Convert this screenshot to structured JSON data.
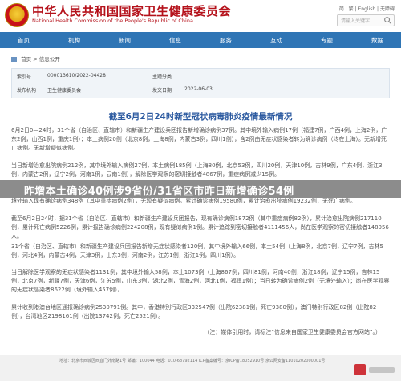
{
  "header": {
    "title_cn": "中华人民共和国国家卫生健康委员会",
    "title_en": "National Health Commission of the People's Republic of China",
    "top_links": "简 | 繁 | English | 无障碍",
    "search_placeholder": "请输入关键字"
  },
  "nav": {
    "items": [
      "首页",
      "机构",
      "新闻",
      "信息",
      "服务",
      "互动",
      "专题",
      "数据"
    ]
  },
  "breadcrumb": {
    "home": "首页",
    "sep": ">",
    "current": "信息公开"
  },
  "meta": {
    "index_label": "索引号",
    "index_value": "000013610/2022-04428",
    "category_label": "主题分类",
    "category_value": "",
    "publisher_label": "发布机构",
    "publisher_value": "卫生健康委员会",
    "date_label": "发文日期",
    "date_value": "2022-06-03"
  },
  "article": {
    "title": "截至6月2日24时新型冠状病毒肺炎疫情最新情况",
    "p1": "6月2日0—24时，31个省（自治区、直辖市）和新疆生产建设兵团报告新增确诊病例37例。其中境外输入病例17例（福建7例，广西4例，上海2例，广东2例，山西1例，重庆1例）；本土病例20例（北京8例，上海8例，内蒙古3例，四川1例），含2例由无症状感染者转为确诊病例（均在上海）。无新增死亡病例。无新增疑似病例。",
    "p2": "当日新增治愈出院病例212例，其中境外输入病例27例，本土病例185例（上海80例，北京53例，四川20例，天津10例，吉林9例，广东4例，浙江3例，内蒙古2例，辽宁2例，河南1例，云南1例），解除医学观察的密切接触者4867例，重症病例减少15例。",
    "p3": "境外输入现有确诊病例348例（其中重症病例2例），无现有疑似病例。累计确诊病例19580例，累计治愈出院病例19232例，无死亡病例。",
    "p4": "截至6月2日24时，据31个省（自治区、直辖市）和新疆生产建设兵团报告，现有确诊病例1872例（其中重症病例82例），累计治愈出院病例217110例，累计死亡病例5226例，累计报告确诊病例224208例，现有疑似病例1例。累计追踪到密切接触者4111456人，尚在医学观察的密切接触者148056人。",
    "p5": "31个省（自治区、直辖市）和新疆生产建设兵团报告新增无症状感染者120例，其中境外输入66例，本土54例（上海8例，北京7例，辽宁7例，吉林5例，河北4例，内蒙古4例，天津3例，山东3例，河南2例，江苏1例，浙江1例，四川1例）。",
    "p6": "当日解除医学观察的无症状感染者1131例，其中境外输入58例，本土1073例（上海867例，四川81例，河南40例，浙江18例，辽宁15例，吉林15例，北京7例，新疆7例，天津6例，江苏5例，山东3例，湖北2例，青海2例，河北1例，福建1例）；当日转为确诊病例2例（无境外输入）；尚在医学观察的无症状感染者8622例（境外输入457例）。",
    "p7": "累计收到港澳台地区通报确诊病例2530791例。其中，香港特别行政区332547例（出院62381例，死亡9380例），澳门特别行政区82例（出院82例），台湾地区2198161例（出院13742例，死亡2521例）。",
    "source": "（注：媒体引用时，请标注“信息来自国家卫生健康委员会官方网站”。）"
  },
  "banner": {
    "headline": "昨增本土确诊40例涉9省份/31省区市昨日新增确诊54例"
  },
  "footer": {
    "text": "地址：北京市西城区西直门外南路1号  邮编：100044  电话：010-68792114  ICP备案编号：京ICP备18052910号  京公网安备11010202000001号"
  },
  "colors": {
    "brand_red": "#b5121b",
    "nav_blue": "#2f75b5",
    "title_blue": "#2c5aa0"
  }
}
